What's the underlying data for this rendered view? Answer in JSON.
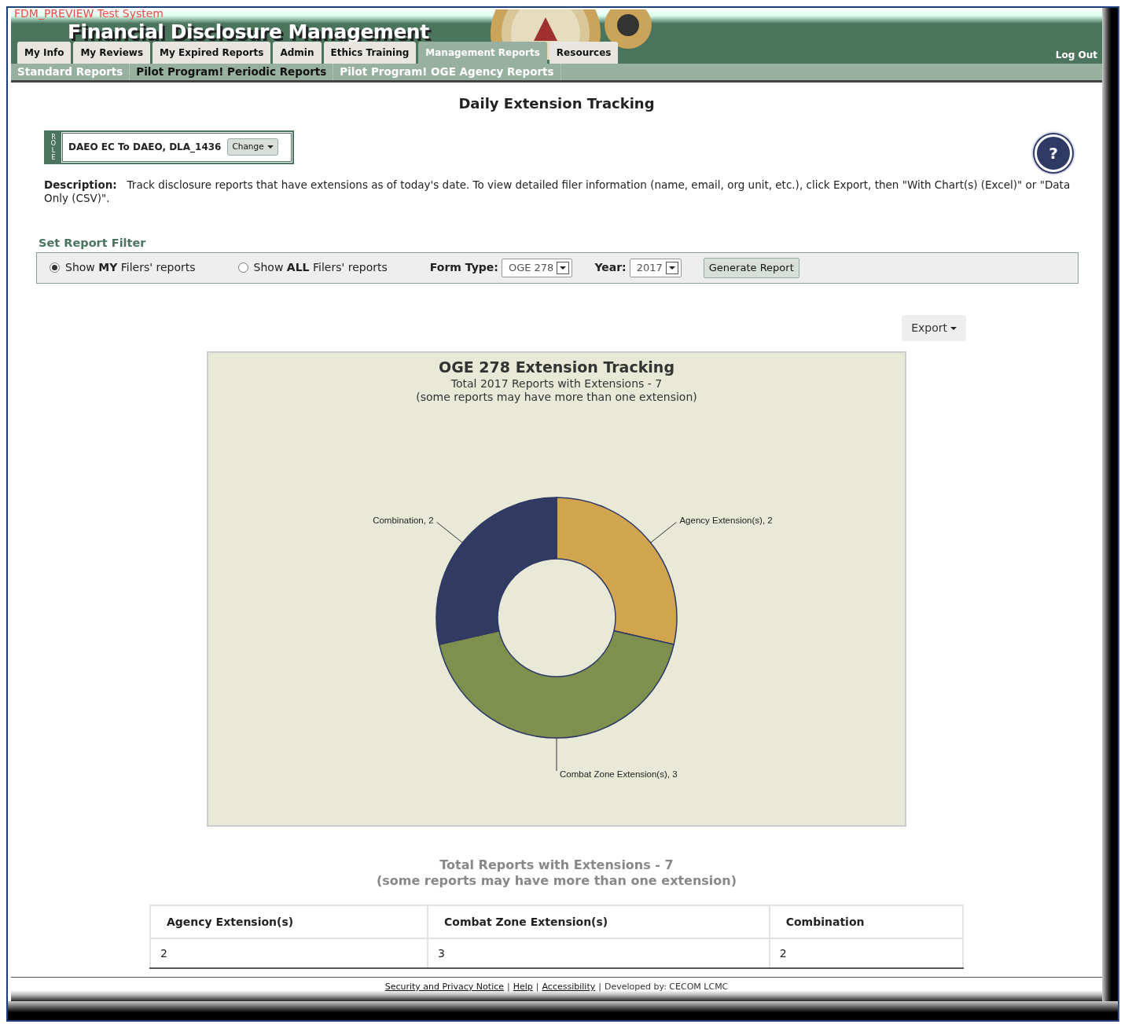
{
  "header": {
    "system_label": "FDM_PREVIEW Test System",
    "title": "Financial Disclosure Management",
    "logout": "Log Out"
  },
  "tabs": [
    {
      "label": "My Info",
      "selected": false
    },
    {
      "label": "My Reviews",
      "selected": false
    },
    {
      "label": "My Expired Reports",
      "selected": false
    },
    {
      "label": "Admin",
      "selected": false
    },
    {
      "label": "Ethics Training",
      "selected": false
    },
    {
      "label": "Management Reports",
      "selected": true
    },
    {
      "label": "Resources",
      "selected": false
    }
  ],
  "subnav": [
    {
      "label": "Standard Reports",
      "selected": false
    },
    {
      "label": "Pilot Program! Periodic Reports",
      "selected": true
    },
    {
      "label": "Pilot Program! OGE Agency Reports",
      "selected": false
    }
  ],
  "page_title": "Daily Extension Tracking",
  "role": {
    "tag": "ROLE",
    "value": "DAEO EC To DAEO, DLA_1436",
    "button": "Change"
  },
  "help": {
    "label": "?"
  },
  "description": {
    "label": "Description:",
    "text": "Track disclosure reports that have extensions as of today's date. To view detailed filer information (name, email, org unit, etc.), click Export, then \"With Chart(s) (Excel)\" or \"Data Only (CSV)\"."
  },
  "filter": {
    "legend": "Set Report Filter",
    "radios": [
      {
        "label": "Show **MY** Filers' reports",
        "selected": true
      },
      {
        "label": "Show **ALL** Filers' reports",
        "selected": false
      }
    ],
    "selects": [
      {
        "label": "Form Type:",
        "value": "OGE 278"
      },
      {
        "label": "Year:",
        "value": "2017"
      }
    ],
    "button": "Generate Report"
  },
  "export": {
    "label": "Export"
  },
  "chart": {
    "subtitles": [
      "Total 2017 Reports with Extensions - 7",
      "(some reports may have more than one extension)"
    ],
    "chart_data": {
      "type": "donut",
      "title": "OGE 278 Extension Tracking",
      "values": [
        2,
        3,
        2
      ],
      "colors": [
        "#d1a44f",
        "#7f8f4e",
        "#313b62"
      ],
      "value_labels": [
        "Agency Extension(s), 2",
        "Combat Zone Extension(s), 3",
        "Combination, 2"
      ]
    }
  },
  "totals": [
    "Total Reports with Extensions - 7",
    "(some reports may have more than one extension)"
  ],
  "table": {
    "columns": [
      "Agency Extension(s)",
      "Combat Zone Extension(s)",
      "Combination"
    ],
    "rows": [
      [
        "2",
        "3",
        "2"
      ]
    ]
  },
  "footer": {
    "links": [
      "Security and Privacy Notice",
      "Help",
      "Accessibility"
    ],
    "separator": "|",
    "credit": "Developed by: CECOM LCMC"
  }
}
